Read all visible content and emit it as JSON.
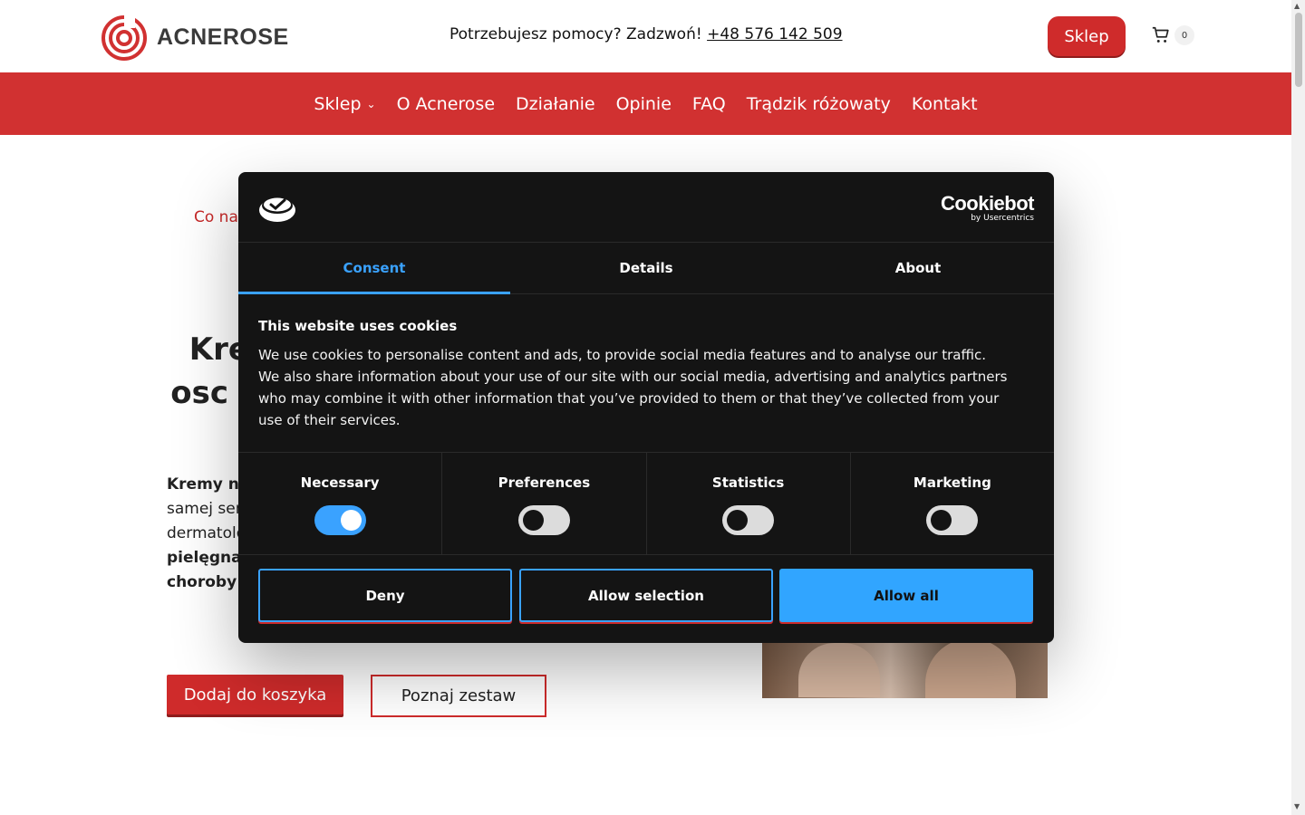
{
  "header": {
    "logo_text": "ACNEROSE",
    "help_text": "Potrzebujesz pomocy? Zadzwoń!",
    "phone": "+48 576 142 509",
    "shop_button": "Sklep",
    "cart_count": "0"
  },
  "nav": {
    "items": [
      "Sklep",
      "O Acnerose",
      "Działanie",
      "Opinie",
      "FAQ",
      "Trądzik różowaty",
      "Kontakt"
    ],
    "dropdown_chevron": "⌄"
  },
  "hero": {
    "breadcrumb": "Co na",
    "title": "Kren osc tra",
    "desc_bold1": "Kremy n",
    "desc_line2": "samej ser",
    "desc_line3": "dermatolo",
    "desc_bold2": "pielęgna",
    "desc_bold3": "choroby",
    "add_to_cart": "Dodaj do koszyka",
    "learn_set": "Poznaj zestaw"
  },
  "cookie": {
    "brand": "Cookiebot",
    "brand_sub": "by Usercentrics",
    "tabs": [
      "Consent",
      "Details",
      "About"
    ],
    "active_tab": "Consent",
    "title": "This website uses cookies",
    "text": "We use cookies to personalise content and ads, to provide social media features and to analyse our traffic. We also share information about your use of our site with our social media, advertising and analytics partners who may combine it with other information that you’ve provided to them or that they’ve collected from your use of their services.",
    "toggles": [
      {
        "label": "Necessary",
        "on": true
      },
      {
        "label": "Preferences",
        "on": false
      },
      {
        "label": "Statistics",
        "on": false
      },
      {
        "label": "Marketing",
        "on": false
      }
    ],
    "buttons": {
      "deny": "Deny",
      "selection": "Allow selection",
      "all": "Allow all"
    }
  },
  "colors": {
    "brand_red": "#d13131",
    "accent_blue": "#3aa2ff",
    "dialog_bg": "#141414"
  }
}
